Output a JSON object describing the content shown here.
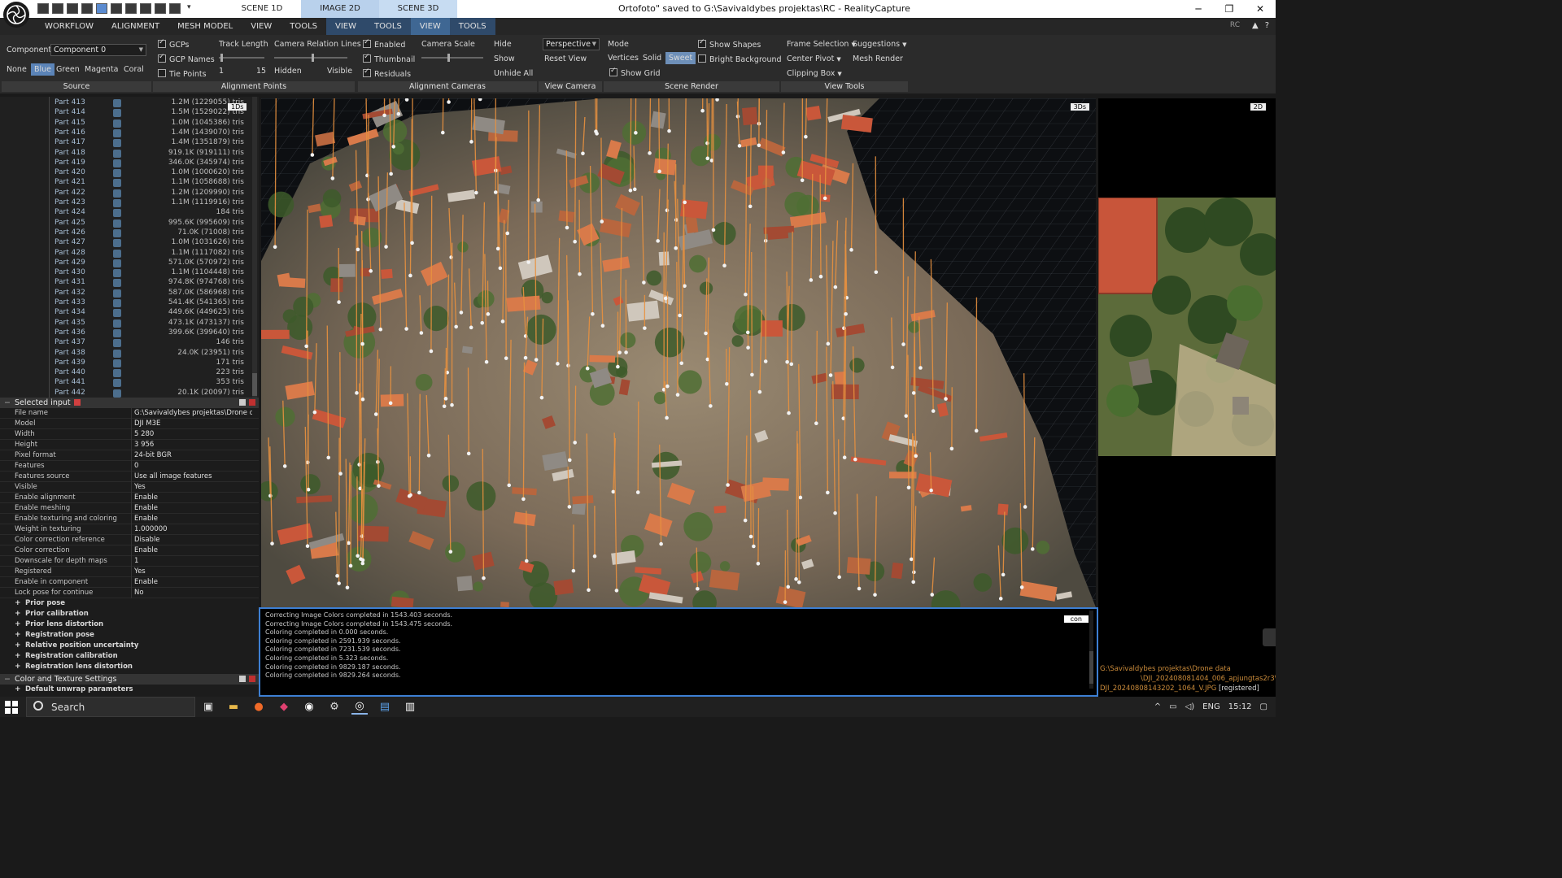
{
  "titlebar": {
    "title": "Ortofoto\" saved to G:\\Savivaldybes projektas\\RC - RealityCapture",
    "scene_tabs": [
      "SCENE 1D",
      "IMAGE 2D",
      "SCENE 3D"
    ],
    "minimize": "─",
    "restore": "❐",
    "close": "✕",
    "qa_dropdown": "▾"
  },
  "menubar": {
    "items": [
      "WORKFLOW",
      "ALIGNMENT",
      "MESH MODEL",
      "VIEW",
      "TOOLS",
      "VIEW",
      "TOOLS",
      "VIEW",
      "TOOLS"
    ],
    "rc_label": "RC"
  },
  "ribbon": {
    "source": {
      "label": "Source",
      "component_label": "Component",
      "component_value": "Component 0",
      "colors": [
        "None",
        "Blue",
        "Green",
        "Magenta",
        "Coral"
      ],
      "selected_color": "Blue"
    },
    "alignment_points": {
      "label": "Alignment Points",
      "gcps": "GCPs",
      "gcp_names": "GCP Names",
      "tie_points": "Tie Points",
      "track_length": "Track Length",
      "track_min": "1",
      "track_max": "15",
      "camera_relation_lines": "Camera Relation Lines",
      "hidden": "Hidden",
      "visible": "Visible"
    },
    "alignment_cameras": {
      "label": "Alignment Cameras",
      "enabled": "Enabled",
      "thumbnail": "Thumbnail",
      "residuals": "Residuals",
      "camera_scale": "Camera Scale",
      "hide": "Hide",
      "show": "Show",
      "unhide_all": "Unhide All"
    },
    "view_camera": {
      "label": "View Camera",
      "projection": "Perspective",
      "reset_view": "Reset View"
    },
    "scene_render": {
      "label": "Scene Render",
      "mode": "Mode",
      "modes": [
        "Vertices",
        "Solid",
        "Sweet"
      ],
      "selected_mode": "Sweet",
      "show_shapes": "Show Shapes",
      "bright_background": "Bright Background",
      "show_grid": "Show Grid"
    },
    "view_tools": {
      "label": "View Tools",
      "frame_selection": "Frame Selection",
      "suggestions": "Suggestions",
      "center_pivot": "Center Pivot",
      "mesh_render": "Mesh Render",
      "clipping_box": "Clipping Box"
    }
  },
  "parts": [
    {
      "name": "Part 413",
      "value": "1.2M (1229055) tris"
    },
    {
      "name": "Part 414",
      "value": "1.5M (1529022) tris"
    },
    {
      "name": "Part 415",
      "value": "1.0M (1045386) tris"
    },
    {
      "name": "Part 416",
      "value": "1.4M (1439070) tris"
    },
    {
      "name": "Part 417",
      "value": "1.4M (1351879) tris"
    },
    {
      "name": "Part 418",
      "value": "919.1K (919111) tris"
    },
    {
      "name": "Part 419",
      "value": "346.0K (345974) tris"
    },
    {
      "name": "Part 420",
      "value": "1.0M (1000620) tris"
    },
    {
      "name": "Part 421",
      "value": "1.1M (1058688) tris"
    },
    {
      "name": "Part 422",
      "value": "1.2M (1209990) tris"
    },
    {
      "name": "Part 423",
      "value": "1.1M (1119916) tris"
    },
    {
      "name": "Part 424",
      "value": "184 tris"
    },
    {
      "name": "Part 425",
      "value": "995.6K (995609) tris"
    },
    {
      "name": "Part 426",
      "value": "71.0K (71008) tris"
    },
    {
      "name": "Part 427",
      "value": "1.0M (1031626) tris"
    },
    {
      "name": "Part 428",
      "value": "1.1M (1117082) tris"
    },
    {
      "name": "Part 429",
      "value": "571.0K (570972) tris"
    },
    {
      "name": "Part 430",
      "value": "1.1M (1104448) tris"
    },
    {
      "name": "Part 431",
      "value": "974.8K (974768) tris"
    },
    {
      "name": "Part 432",
      "value": "587.0K (586968) tris"
    },
    {
      "name": "Part 433",
      "value": "541.4K (541365) tris"
    },
    {
      "name": "Part 434",
      "value": "449.6K (449625) tris"
    },
    {
      "name": "Part 435",
      "value": "473.1K (473137) tris"
    },
    {
      "name": "Part 436",
      "value": "399.6K (399640) tris"
    },
    {
      "name": "Part 437",
      "value": "146 tris"
    },
    {
      "name": "Part 438",
      "value": "24.0K (23951) tris"
    },
    {
      "name": "Part 439",
      "value": "171 tris"
    },
    {
      "name": "Part 440",
      "value": "223 tris"
    },
    {
      "name": "Part 441",
      "value": "353 tris"
    },
    {
      "name": "Part 442",
      "value": "20.1K (20097) tris"
    }
  ],
  "left_top_badge": "1Ds",
  "selected_input": {
    "title": "Selected input",
    "props": [
      {
        "k": "File name",
        "v": "G:\\Savivaldybes projektas\\Drone d..."
      },
      {
        "k": "Model",
        "v": "DJI M3E"
      },
      {
        "k": "Width",
        "v": "5 280"
      },
      {
        "k": "Height",
        "v": "3 956"
      },
      {
        "k": "Pixel format",
        "v": "24-bit BGR"
      },
      {
        "k": "Features",
        "v": "0"
      },
      {
        "k": "Features source",
        "v": "Use all image features"
      },
      {
        "k": "Visible",
        "v": "Yes"
      },
      {
        "k": "Enable alignment",
        "v": "Enable"
      },
      {
        "k": "Enable meshing",
        "v": "Enable"
      },
      {
        "k": "Enable texturing and coloring",
        "v": "Enable"
      },
      {
        "k": "Weight in texturing",
        "v": "1.000000"
      },
      {
        "k": "Color correction reference",
        "v": "Disable"
      },
      {
        "k": "Color correction",
        "v": "Enable"
      },
      {
        "k": "Downscale for depth maps",
        "v": "1"
      },
      {
        "k": "Registered",
        "v": "Yes"
      },
      {
        "k": "Enable in component",
        "v": "Enable"
      },
      {
        "k": "Lock pose for continue",
        "v": "No"
      }
    ],
    "sections": [
      "Prior pose",
      "Prior calibration",
      "Prior lens distortion",
      "Registration pose",
      "Relative position uncertainty",
      "Registration calibration",
      "Registration lens distortion"
    ]
  },
  "color_texture": {
    "title": "Color and Texture Settings",
    "sections": [
      "Default unwrap parameters"
    ]
  },
  "view3d": {
    "tag": "3Ds"
  },
  "console": {
    "tag": "con",
    "lines": [
      "Correcting Image Colors completed in 1543.403 seconds.",
      "Correcting Image Colors completed in 1543.475 seconds.",
      "Coloring completed in 0.000 seconds.",
      "Coloring completed in 2591.939 seconds.",
      "Coloring completed in 7231.539 seconds.",
      "Coloring completed in 5.323 seconds.",
      "Coloring completed in 9829.187 seconds.",
      "Coloring completed in 9829.264 seconds."
    ]
  },
  "view2d": {
    "tag": "2D",
    "path1": "G:\\Savivaldybes projektas\\Drone data",
    "path2": "\\DJI_202408081404_006_apjungtas2r3\\",
    "path3": "DJI_20240808143202_1064_V.JPG",
    "status": "[registered]"
  },
  "taskbar": {
    "search_label": "Search",
    "lang": "ENG",
    "time": "15:12"
  },
  "colors": {
    "accent": "#3d7fd3",
    "ribbon_bg": "#2b2b2b",
    "panel_bg": "#1c1c1c",
    "camera_line": "#e8913f",
    "roof": "#c9573a"
  }
}
